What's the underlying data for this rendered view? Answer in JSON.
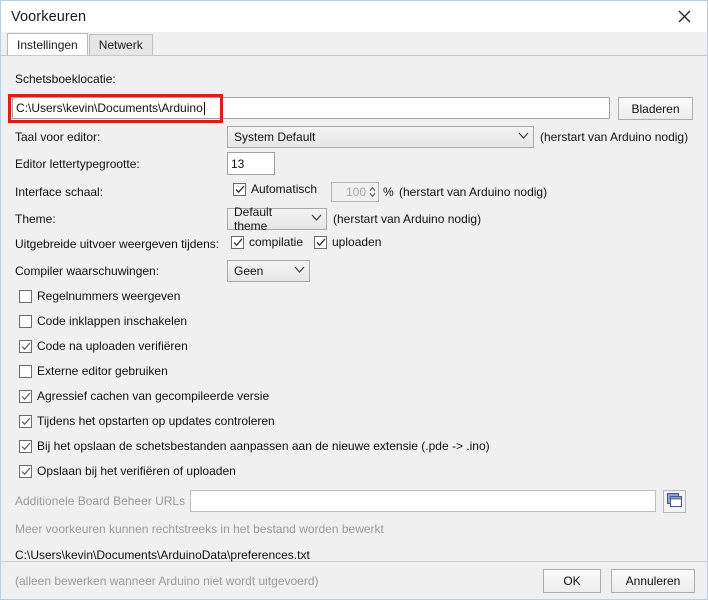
{
  "window": {
    "title": "Voorkeuren",
    "close_icon": "close-icon"
  },
  "tabs": [
    {
      "label": "Instellingen",
      "active": true
    },
    {
      "label": "Netwerk",
      "active": false
    }
  ],
  "settings": {
    "sketchbook": {
      "label": "Schetsboeklocatie:",
      "value": "C:\\Users\\kevin\\Documents\\Arduino",
      "browse_label": "Bladeren"
    },
    "editor_language": {
      "label": "Taal voor editor:",
      "value": "System Default",
      "note": "(herstart van Arduino nodig)",
      "chevron": "chevron-down-icon"
    },
    "editor_font_size": {
      "label": "Editor lettertypegrootte:",
      "value": "13"
    },
    "interface_scale": {
      "label": "Interface schaal:",
      "auto_label": "Automatisch",
      "auto_checked": true,
      "scale_value": "100",
      "percent": "%",
      "note": "(herstart van Arduino nodig)"
    },
    "theme": {
      "label": "Theme:",
      "value": "Default theme",
      "note": "(herstart van Arduino nodig)",
      "chevron": "chevron-down-icon"
    },
    "verbose_output": {
      "label": "Uitgebreide uitvoer weergeven tijdens:",
      "options": [
        {
          "label": "compilatie",
          "checked": true
        },
        {
          "label": "uploaden",
          "checked": true
        }
      ]
    },
    "compiler_warnings": {
      "label": "Compiler waarschuwingen:",
      "value": "Geen",
      "chevron": "chevron-down-icon"
    },
    "checkboxes": [
      {
        "label": "Regelnummers weergeven",
        "checked": false
      },
      {
        "label": "Code inklappen inschakelen",
        "checked": false
      },
      {
        "label": "Code na uploaden verifiëren",
        "checked": true
      },
      {
        "label": "Externe editor gebruiken",
        "checked": false
      },
      {
        "label": "Agressief cachen van gecompileerde versie",
        "checked": true
      },
      {
        "label": "Tijdens het opstarten op updates controleren",
        "checked": true
      },
      {
        "label": "Bij het opslaan de schetsbestanden aanpassen aan de nieuwe extensie (.pde -> .ino)",
        "checked": true
      },
      {
        "label": "Opslaan bij het verifiëren of uploaden",
        "checked": true
      }
    ],
    "board_urls": {
      "label": "Additionele Board Beheer URLs",
      "value": "",
      "icon": "window-copy-icon"
    },
    "info": {
      "line1": "Meer voorkeuren kunnen rechtstreeks in het bestand worden bewerkt",
      "path": "C:\\Users\\kevin\\Documents\\ArduinoData\\preferences.txt",
      "line3": "(alleen bewerken wanneer Arduino niet wordt uitgevoerd)"
    }
  },
  "footer": {
    "ok_label": "OK",
    "cancel_label": "Annuleren"
  },
  "annotation": {
    "color": "#e01b1b"
  }
}
